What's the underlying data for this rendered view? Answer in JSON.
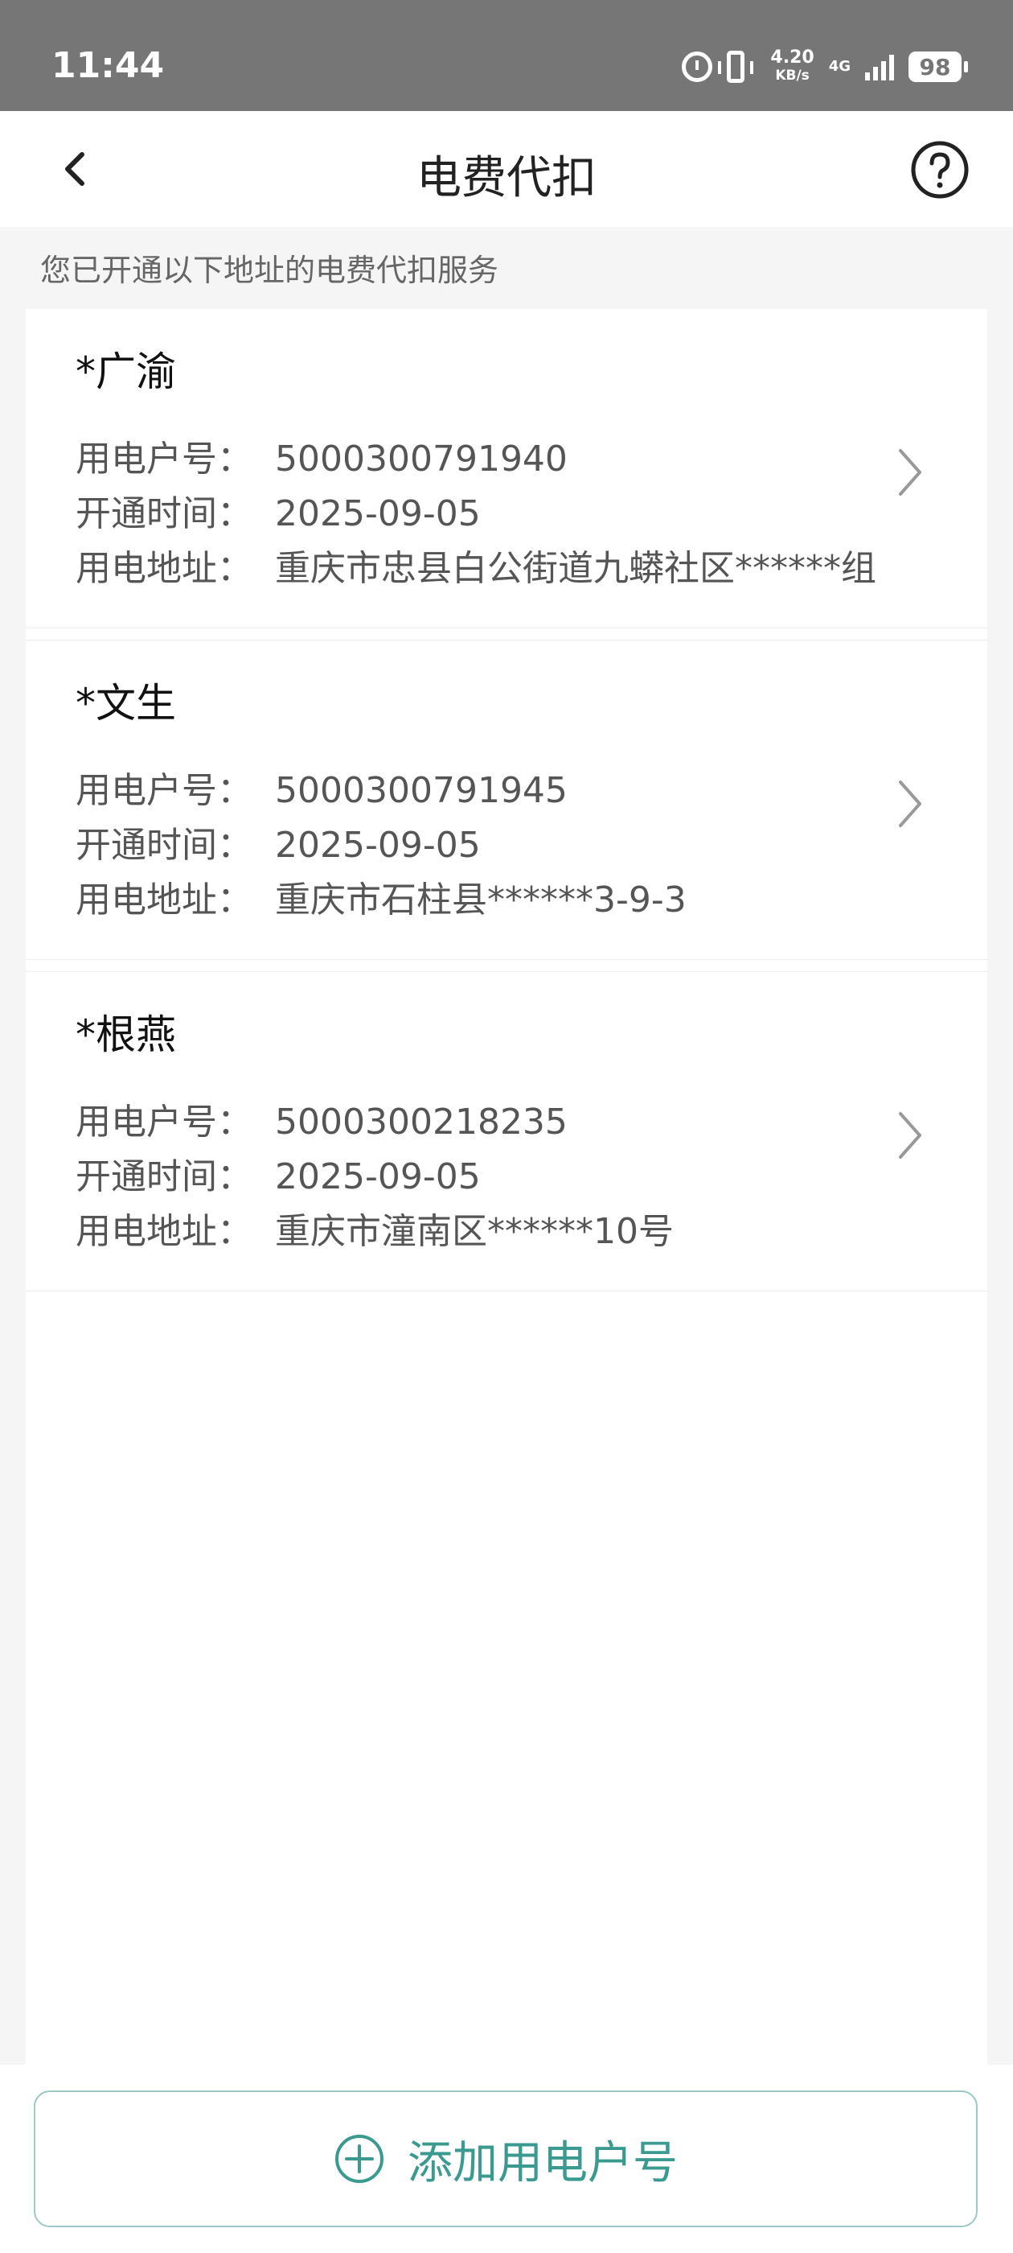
{
  "status_bar": {
    "time": "11:44",
    "speed_value": "4.20",
    "speed_unit": "KB/s",
    "network": "4G",
    "battery": "98"
  },
  "header": {
    "title": "电费代扣",
    "back_icon": "chevron-left",
    "help_icon": "question-circle"
  },
  "subtitle": "您已开通以下地址的电费代扣服务",
  "labels": {
    "account": "用电户号：",
    "open_time": "开通时间：",
    "address": "用电地址："
  },
  "accounts": [
    {
      "name": "*广渝",
      "account_no": "5000300791940",
      "open_date": "2025-09-05",
      "address": "重庆市忠县白公街道九蟒社区******组"
    },
    {
      "name": "*文生",
      "account_no": "5000300791945",
      "open_date": "2025-09-05",
      "address": "重庆市石柱县******3-9-3"
    },
    {
      "name": "*根燕",
      "account_no": "5000300218235",
      "open_date": "2025-09-05",
      "address": "重庆市潼南区******10号"
    }
  ],
  "add_button": {
    "label": "添加用电户号",
    "icon": "plus-circle"
  },
  "colors": {
    "accent": "#3b9a8f",
    "accent_border": "#9cc9c3",
    "status_bar_bg": "#767676"
  }
}
